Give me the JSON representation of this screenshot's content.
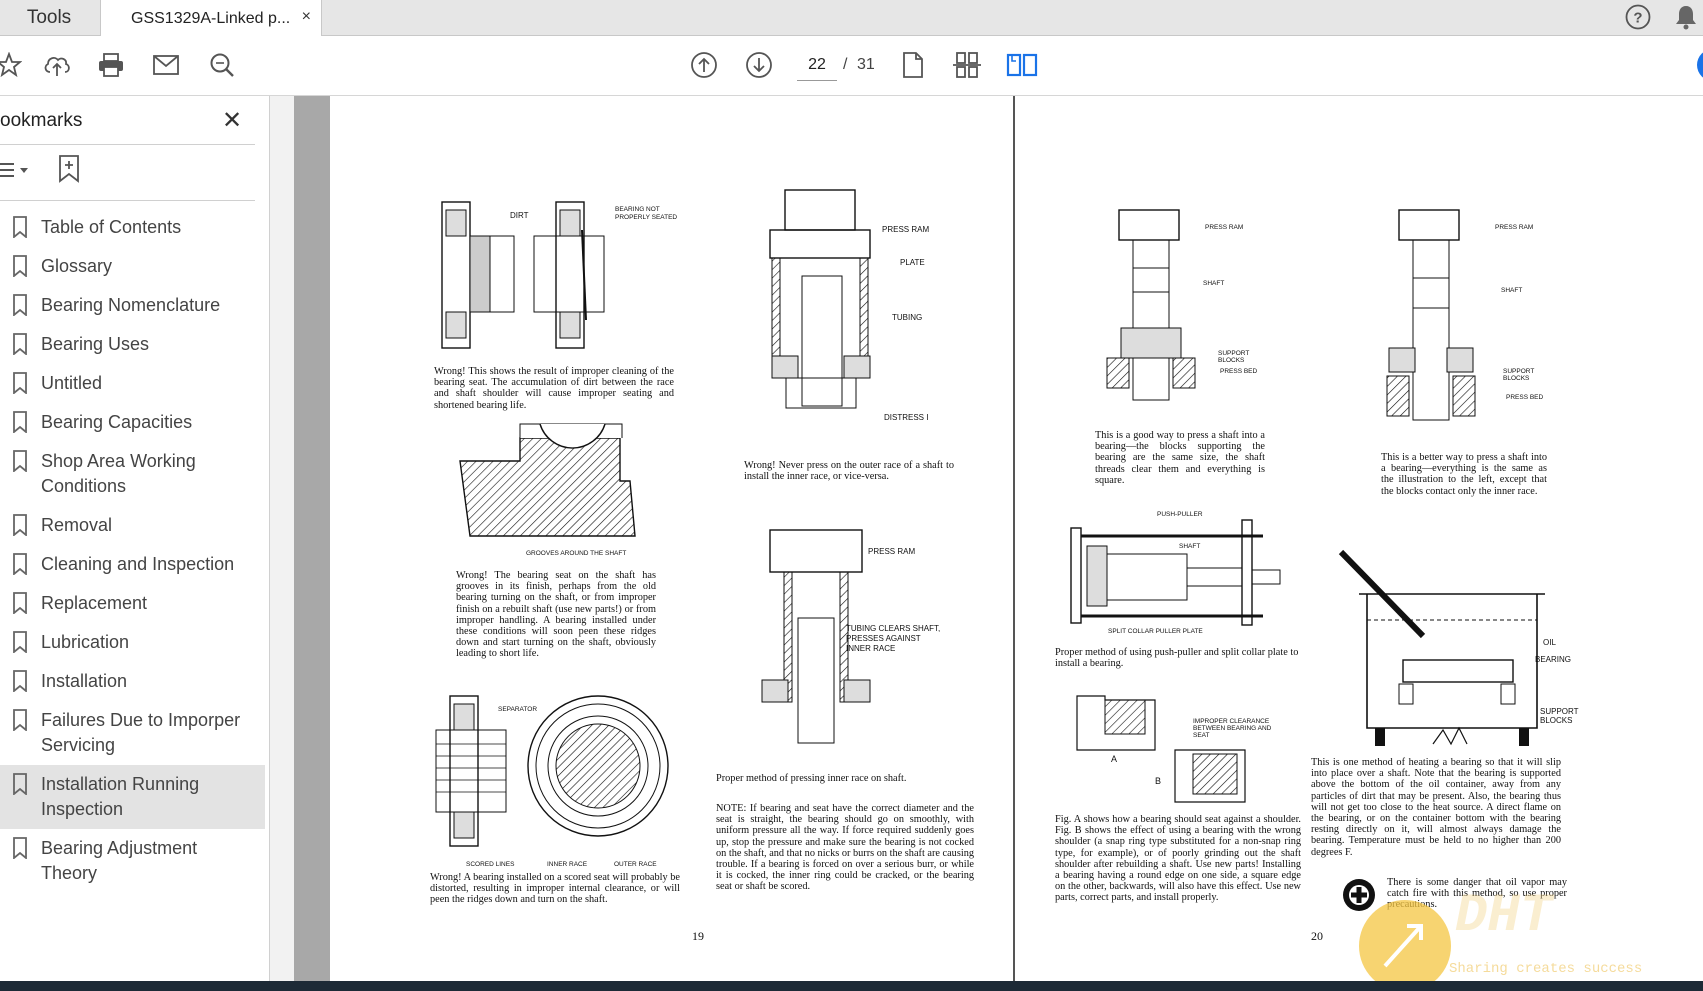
{
  "tabs": {
    "tools_label": "Tools",
    "doc_title": "GSS1329A-Linked p...",
    "close": "×"
  },
  "toolbar": {
    "current_page": "22",
    "separator": "/",
    "total_pages": "31"
  },
  "sidebar": {
    "title": "ookmarks",
    "close": "✕",
    "bookmarks": [
      {
        "label": "Table of Contents"
      },
      {
        "label": "Glossary"
      },
      {
        "label": "Bearing Nomenclature"
      },
      {
        "label": "Bearing Uses"
      },
      {
        "label": "Untitled"
      },
      {
        "label": "Bearing Capacities"
      },
      {
        "label": "Shop Area Working Conditions"
      },
      {
        "label": "Removal"
      },
      {
        "label": "Cleaning and Inspection"
      },
      {
        "label": "Replacement"
      },
      {
        "label": "Lubrication"
      },
      {
        "label": "Installation"
      },
      {
        "label": "Failures Due to Imporper Servicing"
      },
      {
        "label": "Installation Running Inspection",
        "selected": true
      },
      {
        "label": "Bearing Adjustment Theory"
      }
    ]
  },
  "page_left": {
    "number": "19",
    "fig1": {
      "label_dirt": "DIRT",
      "label_notseated": "BEARING NOT PROPERLY SEATED",
      "caption": "Wrong! This shows the result of improper cleaning of the bearing seat. The accumulation of dirt between the race and shaft shoulder will cause improper seating and shortened bearing life."
    },
    "fig2": {
      "label_grooves": "GROOVES AROUND THE SHAFT",
      "caption": "Wrong! The bearing seat on the shaft has grooves in its finish, perhaps from the old bearing turning on the shaft, or from improper finish on a rebuilt shaft (use new parts!) or from improper handling. A bearing installed under these conditions will soon peen these ridges down and start turning on the shaft, obviously leading to short life."
    },
    "fig3": {
      "label_separator": "SEPARATOR",
      "label_scored": "SCORED LINES",
      "label_inner": "INNER RACE",
      "label_outer": "OUTER RACE",
      "caption": "Wrong! A bearing installed on a scored seat will probably be distorted, resulting in improper internal clearance, or will peen the ridges down and turn on the shaft."
    },
    "fig4": {
      "label_ram": "PRESS RAM",
      "label_plate": "PLATE",
      "label_tubing": "TUBING",
      "label_distress": "DISTRESS I",
      "caption": "Wrong! Never press on the outer race of a shaft to install the inner race, or vice-versa."
    },
    "fig5": {
      "label_ram": "PRESS RAM",
      "label_tubing": "TUBING CLEARS SHAFT, PRESSES AGAINST INNER RACE",
      "caption": "Proper method of pressing inner race on shaft."
    },
    "note": "NOTE: If bearing and seat have the correct diameter and the seat is straight, the bearing should go on smoothly, with uniform pressure all the way. If force required suddenly goes up, stop the pressure and make sure the bearing is not cocked on the shaft, and that no nicks or burrs on the shaft are causing trouble. If a bearing is forced on over a serious burr, or while it is cocked, the inner ring could be cracked, or the bearing seat or shaft be scored."
  },
  "page_right": {
    "number": "20",
    "fig1": {
      "label_ram": "PRESS RAM",
      "label_shaft": "SHAFT",
      "label_blocks": "SUPPORT BLOCKS",
      "label_bed": "PRESS BED",
      "caption": "This is a good way to press a shaft into a bearing—the blocks supporting the bearing are the same size, the shaft threads clear them and everything is square."
    },
    "fig2": {
      "label_ram": "PRESS RAM",
      "label_shaft": "SHAFT",
      "label_blocks": "SUPPORT BLOCKS",
      "label_bed": "PRESS BED",
      "caption": "This is a better way to press a shaft into a bearing—everything is the same as the illustration to the left, except that the blocks contact only the inner race."
    },
    "fig3": {
      "label_puller": "PUSH-PULLER",
      "label_shaft": "SHAFT",
      "label_plate": "SPLIT COLLAR PULLER PLATE",
      "caption": "Proper method of using push-puller and split collar plate to install a bearing."
    },
    "fig4": {
      "label_a": "A",
      "label_b": "B",
      "label_clear": "IMPROPER CLEARANCE BETWEEN BEARING AND SEAT",
      "caption": "Fig. A shows how a bearing should seat against a shoulder. Fig. B shows the effect of using a bearing with the wrong shoulder (a snap ring type substituted for a non-snap ring type, for example), or of poorly grinding out the shaft shoulder after rebuilding a shaft. Use new parts! Installing a bearing having a round edge on one side, a square edge on the other, backwards, will also have this effect. Use new parts, correct parts, and install properly."
    },
    "fig5": {
      "label_oil": "OIL",
      "label_bearing": "BEARING",
      "label_blocks": "SUPPORT BLOCKS",
      "caption": "This is one method of heating a bearing so that it will slip into place over a shaft. Note that the bearing is supported above the bottom of the oil container, away from any particles of dirt that may be present. Also, the bearing thus will not get too close to the heat source. A direct flame on the bearing, or on the container bottom with the bearing resting directly on it, will almost always damage the bearing. Temperature must be held to no higher than 200 degrees F."
    },
    "warning": "There is some danger that oil vapor may catch fire with this method, so use proper precautions.",
    "watermark_text": "Sharing creates success",
    "watermark_logo": "DHT"
  },
  "colors": {
    "selected_bookmark": "#e3e3e3",
    "gutter": "#a8a8a8",
    "accent_blue": "#1a73e8"
  }
}
